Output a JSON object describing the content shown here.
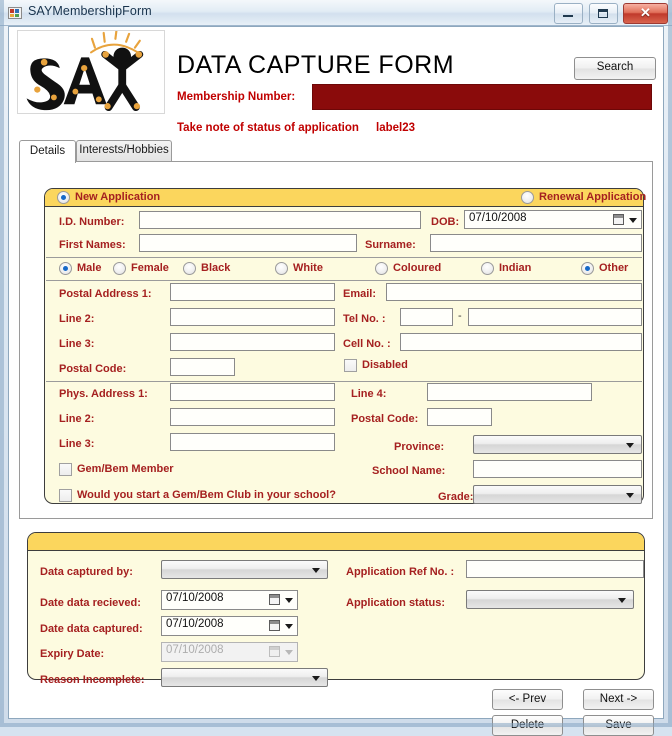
{
  "window": {
    "title": "SAYMembershipForm",
    "minimize": "minimize-button",
    "maximize": "maximize-button",
    "close": "✕"
  },
  "header": {
    "form_title": "DATA CAPTURE FORM",
    "membership_number_label": "Membership Number:",
    "membership_number_value": "",
    "note_label": "Take note of status of application",
    "label23": "label23",
    "search_button": "Search",
    "logo_text": "SAY"
  },
  "tabs": [
    {
      "label": "Details",
      "active": true
    },
    {
      "label": "Interests/Hobbies",
      "active": false
    }
  ],
  "details": {
    "application_type": [
      {
        "label": "New Application",
        "selected": true
      },
      {
        "label": "Renewal Application",
        "selected": false
      }
    ],
    "id_number_label": "I.D. Number:",
    "id_number_value": "",
    "dob_label": "DOB:",
    "dob_value": "07/10/2008",
    "first_names_label": "First Names:",
    "first_names_value": "",
    "surname_label": "Surname:",
    "surname_value": "",
    "gender_race": [
      {
        "label": "Male",
        "selected": true
      },
      {
        "label": "Female",
        "selected": false
      },
      {
        "label": "Black",
        "selected": false
      },
      {
        "label": "White",
        "selected": false
      },
      {
        "label": "Coloured",
        "selected": false
      },
      {
        "label": "Indian",
        "selected": false
      },
      {
        "label": "Other",
        "selected": true
      }
    ],
    "postal_address_1_label": "Postal Address 1:",
    "postal_address_1_value": "",
    "postal_line2_label": "Line 2:",
    "postal_line2_value": "",
    "postal_line3_label": "Line 3:",
    "postal_line3_value": "",
    "postal_code_label": "Postal Code:",
    "postal_code_value": "",
    "email_label": "Email:",
    "email_value": "",
    "tel_no_label": "Tel No. :",
    "tel_code_value": "",
    "tel_separator": "-",
    "tel_number_value": "",
    "cell_no_label": "Cell No. :",
    "cell_no_value": "",
    "disabled_label": "Disabled",
    "disabled_checked": false,
    "phys_address_1_label": "Phys. Address 1:",
    "phys_address_1_value": "",
    "phys_line2_label": "Line 2:",
    "phys_line2_value": "",
    "phys_line3_label": "Line 3:",
    "phys_line3_value": "",
    "line4_label": "Line 4:",
    "line4_value": "",
    "phys_postal_code_label": "Postal Code:",
    "phys_postal_code_value": "",
    "province_label": "Province:",
    "province_value": "",
    "gem_bem_member_label": "Gem/Bem Member",
    "gem_bem_member_checked": false,
    "gem_bem_club_label": "Would you start a Gem/Bem Club in your school?",
    "gem_bem_club_checked": false,
    "school_name_label": "School Name:",
    "school_name_value": "",
    "grade_label": "Grade:",
    "grade_value": ""
  },
  "capture": {
    "data_captured_by_label": "Data captured by:",
    "data_captured_by_value": "",
    "date_received_label": "Date data recieved:",
    "date_received_value": "07/10/2008",
    "date_captured_label": "Date data captured:",
    "date_captured_value": "07/10/2008",
    "expiry_date_label": "Expiry Date:",
    "expiry_date_value": "07/10/2008",
    "reason_incomplete_label": "Reason Incomplete:",
    "reason_incomplete_value": "",
    "app_ref_no_label": "Application Ref No. :",
    "app_ref_no_value": "",
    "app_status_label": "Application status:",
    "app_status_value": ""
  },
  "footer": {
    "prev": "<- Prev",
    "next": "Next ->",
    "delete": "Delete",
    "save": "Save"
  },
  "colors": {
    "label_red": "#a52020",
    "header_red": "#c00000",
    "membership_box": "#8a0b0b",
    "panel_yellow": "#fdfbe0",
    "panel_header_gold": "#fbd65d",
    "accent_blue": "#1769c8"
  }
}
